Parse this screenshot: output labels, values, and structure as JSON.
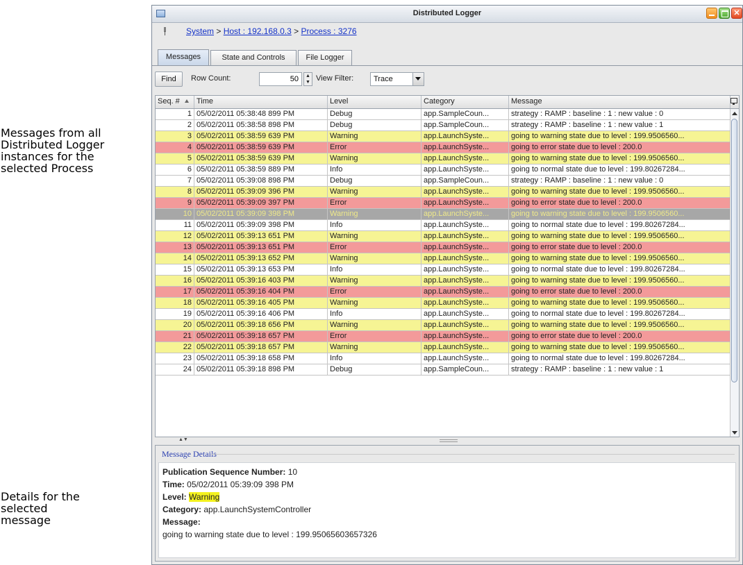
{
  "annotations": {
    "messages_note": "Messages from all Distributed Logger instances for the selected Process",
    "details_note": "Details for the selected message"
  },
  "window": {
    "title": "Distributed Logger"
  },
  "breadcrumb": {
    "system": "System",
    "sep": ">",
    "host": "Host : 192.168.0.3",
    "process": "Process : 3276"
  },
  "tabs": [
    "Messages",
    "State and Controls",
    "File Logger"
  ],
  "active_tab": "Messages",
  "toolbar": {
    "find_label": "Find",
    "row_count_label": "Row Count:",
    "row_count_value": "50",
    "view_filter_label": "View Filter:",
    "view_filter_value": "Trace"
  },
  "columns": [
    "Seq. #",
    "Time",
    "Level",
    "Category",
    "Message"
  ],
  "colors": {
    "Debug": "#ffffff",
    "Info": "#ffffff",
    "Warning": "#f6f494",
    "Error": "#f39a9a",
    "selected": "#a7a7a7",
    "selected_text": "#efe98a"
  },
  "selected_seq": "10",
  "rows": [
    {
      "seq": "1",
      "time": "05/02/2011 05:38:48 899 PM",
      "level": "Debug",
      "category": "app.SampleCoun...",
      "message": "strategy : RAMP : baseline : 1 : new value : 0"
    },
    {
      "seq": "2",
      "time": "05/02/2011 05:38:58 898 PM",
      "level": "Debug",
      "category": "app.SampleCoun...",
      "message": "strategy : RAMP : baseline : 1 : new value : 1"
    },
    {
      "seq": "3",
      "time": "05/02/2011 05:38:59 639 PM",
      "level": "Warning",
      "category": "app.LaunchSyste...",
      "message": "going to warning state due to level : 199.9506560..."
    },
    {
      "seq": "4",
      "time": "05/02/2011 05:38:59 639 PM",
      "level": "Error",
      "category": "app.LaunchSyste...",
      "message": "going to error state due to level : 200.0"
    },
    {
      "seq": "5",
      "time": "05/02/2011 05:38:59 639 PM",
      "level": "Warning",
      "category": "app.LaunchSyste...",
      "message": "going to warning state due to level : 199.9506560..."
    },
    {
      "seq": "6",
      "time": "05/02/2011 05:38:59 889 PM",
      "level": "Info",
      "category": "app.LaunchSyste...",
      "message": "going to normal state due to level : 199.80267284..."
    },
    {
      "seq": "7",
      "time": "05/02/2011 05:39:08 898 PM",
      "level": "Debug",
      "category": "app.SampleCoun...",
      "message": "strategy : RAMP : baseline : 1 : new value : 0"
    },
    {
      "seq": "8",
      "time": "05/02/2011 05:39:09 396 PM",
      "level": "Warning",
      "category": "app.LaunchSyste...",
      "message": "going to warning state due to level : 199.9506560..."
    },
    {
      "seq": "9",
      "time": "05/02/2011 05:39:09 397 PM",
      "level": "Error",
      "category": "app.LaunchSyste...",
      "message": "going to error state due to level : 200.0"
    },
    {
      "seq": "10",
      "time": "05/02/2011 05:39:09 398 PM",
      "level": "Warning",
      "category": "app.LaunchSyste...",
      "message": "going to warning state due to level : 199.9506560..."
    },
    {
      "seq": "11",
      "time": "05/02/2011 05:39:09 398 PM",
      "level": "Info",
      "category": "app.LaunchSyste...",
      "message": "going to normal state due to level : 199.80267284..."
    },
    {
      "seq": "12",
      "time": "05/02/2011 05:39:13 651 PM",
      "level": "Warning",
      "category": "app.LaunchSyste...",
      "message": "going to warning state due to level : 199.9506560..."
    },
    {
      "seq": "13",
      "time": "05/02/2011 05:39:13 651 PM",
      "level": "Error",
      "category": "app.LaunchSyste...",
      "message": "going to error state due to level : 200.0"
    },
    {
      "seq": "14",
      "time": "05/02/2011 05:39:13 652 PM",
      "level": "Warning",
      "category": "app.LaunchSyste...",
      "message": "going to warning state due to level : 199.9506560..."
    },
    {
      "seq": "15",
      "time": "05/02/2011 05:39:13 653 PM",
      "level": "Info",
      "category": "app.LaunchSyste...",
      "message": "going to normal state due to level : 199.80267284..."
    },
    {
      "seq": "16",
      "time": "05/02/2011 05:39:16 403 PM",
      "level": "Warning",
      "category": "app.LaunchSyste...",
      "message": "going to warning state due to level : 199.9506560..."
    },
    {
      "seq": "17",
      "time": "05/02/2011 05:39:16 404 PM",
      "level": "Error",
      "category": "app.LaunchSyste...",
      "message": "going to error state due to level : 200.0"
    },
    {
      "seq": "18",
      "time": "05/02/2011 05:39:16 405 PM",
      "level": "Warning",
      "category": "app.LaunchSyste...",
      "message": "going to warning state due to level : 199.9506560..."
    },
    {
      "seq": "19",
      "time": "05/02/2011 05:39:16 406 PM",
      "level": "Info",
      "category": "app.LaunchSyste...",
      "message": "going to normal state due to level : 199.80267284..."
    },
    {
      "seq": "20",
      "time": "05/02/2011 05:39:18 656 PM",
      "level": "Warning",
      "category": "app.LaunchSyste...",
      "message": "going to warning state due to level : 199.9506560..."
    },
    {
      "seq": "21",
      "time": "05/02/2011 05:39:18 657 PM",
      "level": "Error",
      "category": "app.LaunchSyste...",
      "message": "going to error state due to level : 200.0"
    },
    {
      "seq": "22",
      "time": "05/02/2011 05:39:18 657 PM",
      "level": "Warning",
      "category": "app.LaunchSyste...",
      "message": "going to warning state due to level : 199.9506560..."
    },
    {
      "seq": "23",
      "time": "05/02/2011 05:39:18 658 PM",
      "level": "Info",
      "category": "app.LaunchSyste...",
      "message": "going to normal state due to level : 199.80267284..."
    },
    {
      "seq": "24",
      "time": "05/02/2011 05:39:18 898 PM",
      "level": "Debug",
      "category": "app.SampleCoun...",
      "message": "strategy : RAMP : baseline : 1 : new value : 1"
    }
  ],
  "details": {
    "legend": "Message Details",
    "pub_label": "Publication Sequence Number:",
    "pub_value": "10",
    "time_label": "Time:",
    "time_value": "05/02/2011 05:39:09 398 PM",
    "level_label": "Level:",
    "level_value": "Warning",
    "category_label": "Category:",
    "category_value": "app.LaunchSystemController",
    "message_label": "Message:",
    "message_value": "going to warning state due to level : 199.95065603657326"
  }
}
